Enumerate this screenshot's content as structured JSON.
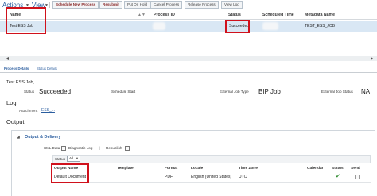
{
  "toolbar": {
    "actions_label": "Actions",
    "view_label": "View",
    "buttons": [
      "Schedule New Process",
      "Resubmit",
      "Put On Hold",
      "Cancel Process",
      "Release Process",
      "View Log"
    ]
  },
  "table": {
    "headers": {
      "name": "Name",
      "process_id": "Process ID",
      "status": "Status",
      "scheduled_time": "Scheduled Time",
      "metadata_name": "Metadata Name"
    },
    "row": {
      "name": "Test ESS Job",
      "status": "Succeeded",
      "metadata_name": "TEST_ESS_JOB"
    }
  },
  "tabs": {
    "process_details": "Process Details",
    "status_details": "Status Details"
  },
  "details": {
    "job_name": "Test ESS Job,",
    "status_label": "Status",
    "status_value": "Succeeded",
    "schedule_start_label": "Schedule Start",
    "external_job_type_label": "External Job Type",
    "external_job_type_value": "BIP Job",
    "external_job_status_label": "External Job Status",
    "external_job_status_value": "NA",
    "log_heading": "Log",
    "attachment_label": "Attachment",
    "attachment_value": "ESS_...",
    "output_heading": "Output"
  },
  "output": {
    "section_label": "Output & Delivery",
    "xml_data_label": "XML Data",
    "diagnostic_log_label": "Diagnostic Log",
    "republish_label": "Republish",
    "status_filter_label": "Status",
    "status_filter_value": "All",
    "headers": {
      "output_name": "Output Name",
      "template": "Template",
      "format": "Format",
      "locale": "Locale",
      "time_zone": "Time Zone",
      "calendar": "Calendar",
      "status": "Status",
      "send": "Send"
    },
    "row": {
      "output_name": "Default Document",
      "format": "PDF",
      "locale": "English (United States)",
      "time_zone": "UTC"
    }
  },
  "colors": {
    "highlight": "#d0111c",
    "selected_row": "#d9e7f4",
    "link": "#2a5d9f"
  }
}
